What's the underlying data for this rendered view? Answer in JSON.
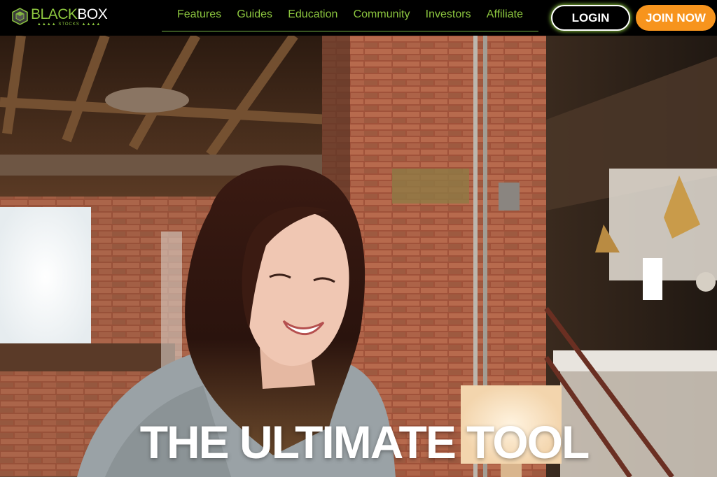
{
  "brand": {
    "name_part1": "BLACK",
    "name_part2": "BOX",
    "tagline": "STOCKS",
    "logo_icon": "hexagon-cube-icon"
  },
  "nav": {
    "items": [
      {
        "label": "Features"
      },
      {
        "label": "Guides"
      },
      {
        "label": "Education"
      },
      {
        "label": "Community"
      },
      {
        "label": "Investors"
      },
      {
        "label": "Affiliate"
      }
    ]
  },
  "auth": {
    "login_label": "LOGIN",
    "join_label": "JOIN NOW"
  },
  "hero": {
    "title": "THE ULTIMATE TOOL",
    "image_desc": "hero-photo"
  },
  "colors": {
    "accent_green": "#8cc63f",
    "join_orange": "#f7941d",
    "header_bg": "#000000"
  }
}
